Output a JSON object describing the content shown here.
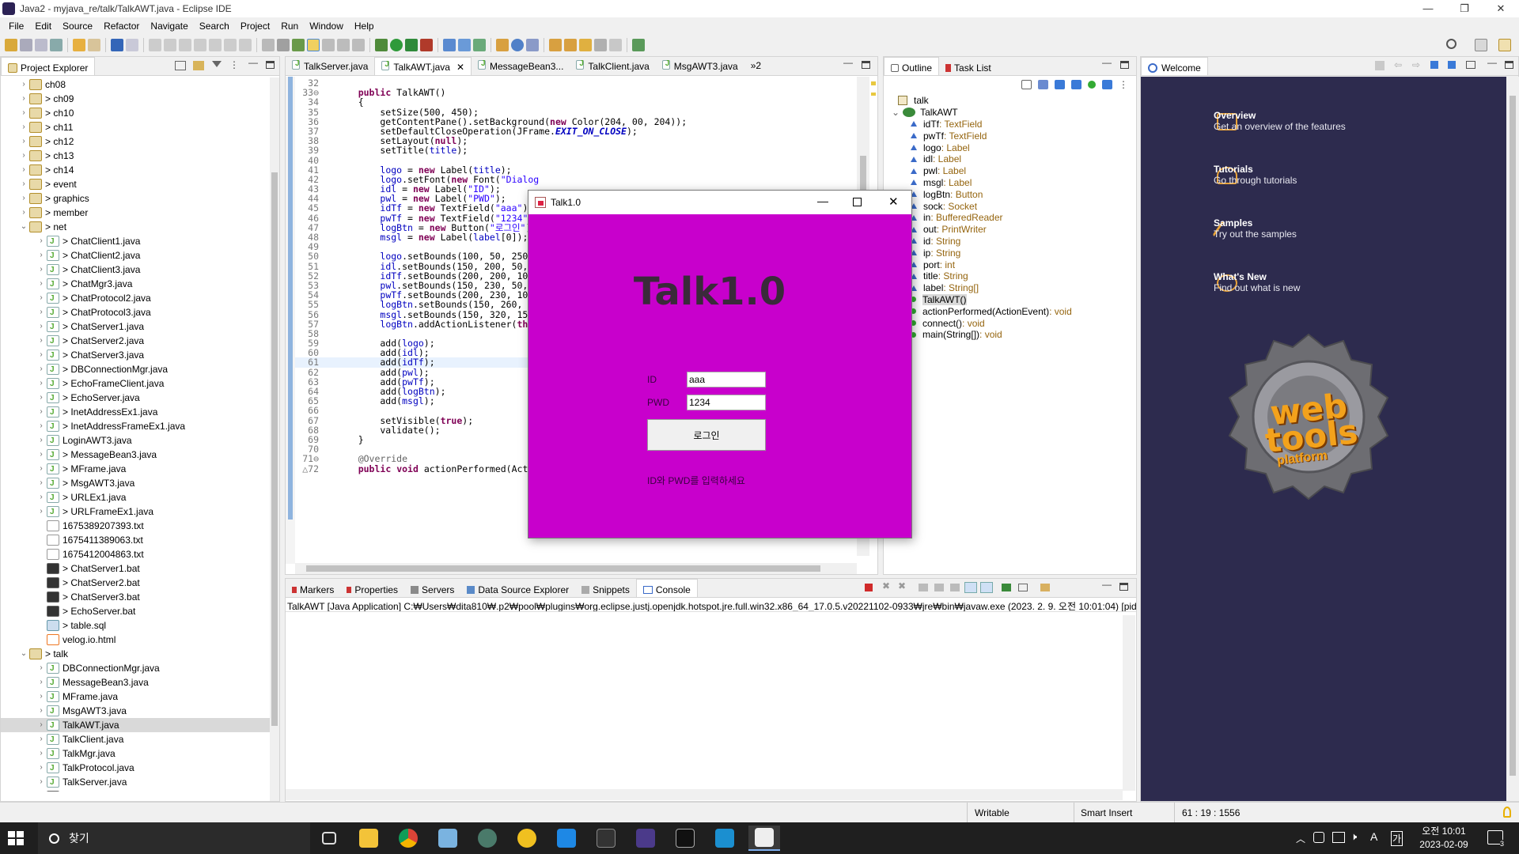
{
  "window": {
    "title": "Java2 - myjava_re/talk/TalkAWT.java - Eclipse IDE",
    "minimize": "—",
    "maximize": "❐",
    "close": "✕"
  },
  "menu": [
    "File",
    "Edit",
    "Source",
    "Refactor",
    "Navigate",
    "Search",
    "Project",
    "Run",
    "Window",
    "Help"
  ],
  "project_explorer": {
    "title": "Project Explorer",
    "items": [
      {
        "label": "ch08",
        "kind": "pkg",
        "indent": 1,
        "tw": ">"
      },
      {
        "label": "> ch09",
        "kind": "pkg",
        "indent": 1,
        "tw": ">"
      },
      {
        "label": "> ch10",
        "kind": "pkg",
        "indent": 1,
        "tw": ">"
      },
      {
        "label": "> ch11",
        "kind": "pkg",
        "indent": 1,
        "tw": ">"
      },
      {
        "label": "> ch12",
        "kind": "pkg",
        "indent": 1,
        "tw": ">"
      },
      {
        "label": "> ch13",
        "kind": "pkg",
        "indent": 1,
        "tw": ">"
      },
      {
        "label": "> ch14",
        "kind": "pkg",
        "indent": 1,
        "tw": ">"
      },
      {
        "label": "> event",
        "kind": "pkg",
        "indent": 1,
        "tw": ">"
      },
      {
        "label": "> graphics",
        "kind": "pkg",
        "indent": 1,
        "tw": ">"
      },
      {
        "label": "> member",
        "kind": "pkg",
        "indent": 1,
        "tw": ">"
      },
      {
        "label": "> net",
        "kind": "pkg",
        "indent": 1,
        "tw": "v"
      },
      {
        "label": "> ChatClient1.java",
        "kind": "jf",
        "indent": 2,
        "tw": ">"
      },
      {
        "label": "> ChatClient2.java",
        "kind": "jf",
        "indent": 2,
        "tw": ">"
      },
      {
        "label": "> ChatClient3.java",
        "kind": "jf",
        "indent": 2,
        "tw": ">"
      },
      {
        "label": "> ChatMgr3.java",
        "kind": "jf",
        "indent": 2,
        "tw": ">"
      },
      {
        "label": "> ChatProtocol2.java",
        "kind": "jf",
        "indent": 2,
        "tw": ">"
      },
      {
        "label": "> ChatProtocol3.java",
        "kind": "jf",
        "indent": 2,
        "tw": ">"
      },
      {
        "label": "> ChatServer1.java",
        "kind": "jf",
        "indent": 2,
        "tw": ">"
      },
      {
        "label": "> ChatServer2.java",
        "kind": "jf",
        "indent": 2,
        "tw": ">"
      },
      {
        "label": "> ChatServer3.java",
        "kind": "jf",
        "indent": 2,
        "tw": ">"
      },
      {
        "label": "> DBConnectionMgr.java",
        "kind": "jf",
        "indent": 2,
        "tw": ">"
      },
      {
        "label": "> EchoFrameClient.java",
        "kind": "jf",
        "indent": 2,
        "tw": ">"
      },
      {
        "label": "> EchoServer.java",
        "kind": "jf",
        "indent": 2,
        "tw": ">"
      },
      {
        "label": "> InetAddressEx1.java",
        "kind": "jf",
        "indent": 2,
        "tw": ">"
      },
      {
        "label": "> InetAddressFrameEx1.java",
        "kind": "jf",
        "indent": 2,
        "tw": ">"
      },
      {
        "label": "LoginAWT3.java",
        "kind": "jf",
        "indent": 2,
        "tw": ">"
      },
      {
        "label": "> MessageBean3.java",
        "kind": "jf",
        "indent": 2,
        "tw": ">"
      },
      {
        "label": "> MFrame.java",
        "kind": "jf",
        "indent": 2,
        "tw": ">"
      },
      {
        "label": "> MsgAWT3.java",
        "kind": "jf",
        "indent": 2,
        "tw": ">"
      },
      {
        "label": "> URLEx1.java",
        "kind": "jf",
        "indent": 2,
        "tw": ">"
      },
      {
        "label": "> URLFrameEx1.java",
        "kind": "jf",
        "indent": 2,
        "tw": ">"
      },
      {
        "label": "1675389207393.txt",
        "kind": "txtf",
        "indent": 2,
        "tw": ""
      },
      {
        "label": "1675411389063.txt",
        "kind": "txtf",
        "indent": 2,
        "tw": ""
      },
      {
        "label": "1675412004863.txt",
        "kind": "txtf",
        "indent": 2,
        "tw": ""
      },
      {
        "label": "> ChatServer1.bat",
        "kind": "batf",
        "indent": 2,
        "tw": ""
      },
      {
        "label": "> ChatServer2.bat",
        "kind": "batf",
        "indent": 2,
        "tw": ""
      },
      {
        "label": "> ChatServer3.bat",
        "kind": "batf",
        "indent": 2,
        "tw": ""
      },
      {
        "label": "> EchoServer.bat",
        "kind": "batf",
        "indent": 2,
        "tw": ""
      },
      {
        "label": "> table.sql",
        "kind": "sqlf",
        "indent": 2,
        "tw": ""
      },
      {
        "label": "velog.io.html",
        "kind": "htmlf",
        "indent": 2,
        "tw": ""
      },
      {
        "label": "> talk",
        "kind": "pkg",
        "indent": 1,
        "tw": "v"
      },
      {
        "label": "DBConnectionMgr.java",
        "kind": "jf",
        "indent": 2,
        "tw": ">"
      },
      {
        "label": "MessageBean3.java",
        "kind": "jf",
        "indent": 2,
        "tw": ">"
      },
      {
        "label": "MFrame.java",
        "kind": "jf",
        "indent": 2,
        "tw": ">"
      },
      {
        "label": "MsgAWT3.java",
        "kind": "jf",
        "indent": 2,
        "tw": ">"
      },
      {
        "label": "TalkAWT.java",
        "kind": "jf",
        "indent": 2,
        "tw": ">",
        "selected": true
      },
      {
        "label": "TalkClient.java",
        "kind": "jf",
        "indent": 2,
        "tw": ">"
      },
      {
        "label": "TalkMgr.java",
        "kind": "jf",
        "indent": 2,
        "tw": ">"
      },
      {
        "label": "TalkProtocol.java",
        "kind": "jf",
        "indent": 2,
        "tw": ">"
      },
      {
        "label": "TalkServer.java",
        "kind": "jf",
        "indent": 2,
        "tw": ">"
      },
      {
        "label": "TalkServer.bat",
        "kind": "batf",
        "indent": 2,
        "tw": ""
      }
    ]
  },
  "editor": {
    "tabs": [
      "TalkServer.java",
      "TalkAWT.java",
      "MessageBean3...",
      "TalkClient.java",
      "MsgAWT3.java"
    ],
    "overflow": "»2",
    "lines": [
      {
        "n": "32",
        "html": ""
      },
      {
        "n": "33⊖",
        "html": "    <span class='kw'>public</span> TalkAWT()"
      },
      {
        "n": "34",
        "html": "    {"
      },
      {
        "n": "35",
        "html": "        setSize(500, 450);"
      },
      {
        "n": "36",
        "html": "        getContentPane().setBackground(<span class='kw'>new</span> Color(204, 00, 204));"
      },
      {
        "n": "37",
        "html": "        setDefaultCloseOperation(JFrame.<span class='cl'>EXIT_ON_CLOSE</span>);"
      },
      {
        "n": "38",
        "html": "        setLayout(<span class='kw'>null</span>);"
      },
      {
        "n": "39",
        "html": "        setTitle(<span class='fd'>title</span>);"
      },
      {
        "n": "40",
        "html": ""
      },
      {
        "n": "41",
        "html": "        <span class='fd'>logo</span> = <span class='kw'>new</span> Label(<span class='fd'>title</span>);"
      },
      {
        "n": "42",
        "html": "        <span class='fd'>logo</span>.setFont(<span class='kw'>new</span> Font(<span class='st'>\"Dialog</span>"
      },
      {
        "n": "43",
        "html": "        <span class='fd'>idl</span> = <span class='kw'>new</span> Label(<span class='st'>\"ID\"</span>);"
      },
      {
        "n": "44",
        "html": "        <span class='fd'>pwl</span> = <span class='kw'>new</span> Label(<span class='st'>\"PWD\"</span>);"
      },
      {
        "n": "45",
        "html": "        <span class='fd'>idTf</span> = <span class='kw'>new</span> TextField(<span class='st'>\"aaa\"</span>);"
      },
      {
        "n": "46",
        "html": "        <span class='fd'>pwTf</span> = <span class='kw'>new</span> TextField(<span class='st'>\"1234\"</span>);"
      },
      {
        "n": "47",
        "html": "        <span class='fd'>logBtn</span> = <span class='kw'>new</span> Button(<span class='st'>\"로그인\"</span>);"
      },
      {
        "n": "48",
        "html": "        <span class='fd'>msgl</span> = <span class='kw'>new</span> Label(<span class='fd'>label</span>[0]);"
      },
      {
        "n": "49",
        "html": ""
      },
      {
        "n": "50",
        "html": "        <span class='fd'>logo</span>.setBounds(100, 50, 250,"
      },
      {
        "n": "51",
        "html": "        <span class='fd'>idl</span>.setBounds(150, 200, 50, 2"
      },
      {
        "n": "52",
        "html": "        <span class='fd'>idTf</span>.setBounds(200, 200, 100,"
      },
      {
        "n": "53",
        "html": "        <span class='fd'>pwl</span>.setBounds(150, 230, 50, 2"
      },
      {
        "n": "54",
        "html": "        <span class='fd'>pwTf</span>.setBounds(200, 230, 100,"
      },
      {
        "n": "55",
        "html": "        <span class='fd'>logBtn</span>.setBounds(150, 260, 15"
      },
      {
        "n": "56",
        "html": "        <span class='fd'>msgl</span>.setBounds(150, 320, 150,"
      },
      {
        "n": "57",
        "html": "        <span class='fd'>logBtn</span>.addActionListener(<span class='kw'>this</span>"
      },
      {
        "n": "58",
        "html": ""
      },
      {
        "n": "59",
        "html": "        add(<span class='fd'>logo</span>);"
      },
      {
        "n": "60",
        "html": "        add(<span class='fd'>idl</span>);"
      },
      {
        "n": "61",
        "html": "        add(<span class='fd'>idTf</span>);"
      },
      {
        "n": "62",
        "html": "        add(<span class='fd'>pwl</span>);"
      },
      {
        "n": "63",
        "html": "        add(<span class='fd'>pwTf</span>);"
      },
      {
        "n": "64",
        "html": "        add(<span class='fd'>logBtn</span>);"
      },
      {
        "n": "65",
        "html": "        add(<span class='fd'>msgl</span>);"
      },
      {
        "n": "66",
        "html": ""
      },
      {
        "n": "67",
        "html": "        setVisible(<span class='kw'>true</span>);"
      },
      {
        "n": "68",
        "html": "        validate();"
      },
      {
        "n": "69",
        "html": "    }"
      },
      {
        "n": "70",
        "html": ""
      },
      {
        "n": "71⊖",
        "html": "    <span class='an'>@Override</span>"
      },
      {
        "n": "△72",
        "html": "    <span class='kw'>public</span> <span class='kw'>void</span> actionPerformed(ActionEvent e)"
      }
    ]
  },
  "outline": {
    "tabs": [
      "Outline",
      "Task List"
    ],
    "items": [
      {
        "name": "talk",
        "type": "",
        "kind": "pkg",
        "indent": 0
      },
      {
        "name": "TalkAWT",
        "type": "",
        "kind": "class",
        "indent": 0
      },
      {
        "name": "idTf",
        "type": " : TextField",
        "kind": "field",
        "indent": 1
      },
      {
        "name": "pwTf",
        "type": " : TextField",
        "kind": "field",
        "indent": 1
      },
      {
        "name": "logo",
        "type": " : Label",
        "kind": "field",
        "indent": 1
      },
      {
        "name": "idl",
        "type": " : Label",
        "kind": "field",
        "indent": 1
      },
      {
        "name": "pwl",
        "type": " : Label",
        "kind": "field",
        "indent": 1
      },
      {
        "name": "msgl",
        "type": " : Label",
        "kind": "field",
        "indent": 1
      },
      {
        "name": "logBtn",
        "type": " : Button",
        "kind": "field",
        "indent": 1
      },
      {
        "name": "sock",
        "type": " : Socket",
        "kind": "field",
        "indent": 1
      },
      {
        "name": "in",
        "type": " : BufferedReader",
        "kind": "field",
        "indent": 1
      },
      {
        "name": "out",
        "type": " : PrintWriter",
        "kind": "field",
        "indent": 1
      },
      {
        "name": "id",
        "type": " : String",
        "kind": "field",
        "indent": 1
      },
      {
        "name": "ip",
        "type": " : String",
        "kind": "field",
        "indent": 1
      },
      {
        "name": "port",
        "type": " : int",
        "kind": "field",
        "indent": 1
      },
      {
        "name": "title",
        "type": " : String",
        "kind": "field",
        "indent": 1
      },
      {
        "name": "label",
        "type": " : String[]",
        "kind": "field",
        "indent": 1
      },
      {
        "name": "TalkAWT()",
        "type": "",
        "kind": "method",
        "indent": 1,
        "selected": true
      },
      {
        "name": "actionPerformed(ActionEvent)",
        "type": " : void",
        "kind": "method",
        "indent": 1
      },
      {
        "name": "connect()",
        "type": " : void",
        "kind": "method",
        "indent": 1
      },
      {
        "name": "main(String[])",
        "type": " : void",
        "kind": "method",
        "indent": 1
      }
    ]
  },
  "welcome": {
    "tab": "Welcome",
    "items": [
      {
        "head": "Overview",
        "desc": "Get an overview of the features"
      },
      {
        "head": "Tutorials",
        "desc": "Go through tutorials"
      },
      {
        "head": "Samples",
        "desc": "Try out the samples"
      },
      {
        "head": "What's New",
        "desc": "Find out what is new"
      }
    ],
    "logo_text": "web tools platform"
  },
  "console": {
    "tabs": [
      "Markers",
      "Properties",
      "Servers",
      "Data Source Explorer",
      "Snippets",
      "Console"
    ],
    "status_line": "TalkAWT [Java Application] C:₩Users₩dita810₩.p2₩pool₩plugins₩org.eclipse.justj.openjdk.hotspot.jre.full.win32.x86_64_17.0.5.v20221102-0933₩jre₩bin₩javaw.exe  (2023. 2. 9. 오전 10:01:04) [pid"
  },
  "statusbar": {
    "mode": "Writable",
    "insert": "Smart Insert",
    "position": "61 : 19 : 1556"
  },
  "talk_window": {
    "title": "Talk1.0",
    "logo": "Talk1.0",
    "id_label": "ID",
    "pwd_label": "PWD",
    "id_value": "aaa",
    "pwd_value": "1234",
    "login_button": "로그인",
    "message": "ID와 PWD를 입력하세요",
    "bg": "#c800cc"
  },
  "taskbar": {
    "search": "찾기",
    "time": "오전 10:01",
    "date": "2023-02-09",
    "ime": "A",
    "ime2": "가",
    "notif": "3",
    "apps": [
      "task-view",
      "file-explorer",
      "chrome",
      "notes",
      "app5",
      "messenger",
      "vscode",
      "terminal-dark",
      "eclipse-app",
      "cmd",
      "store",
      "java-app"
    ]
  }
}
